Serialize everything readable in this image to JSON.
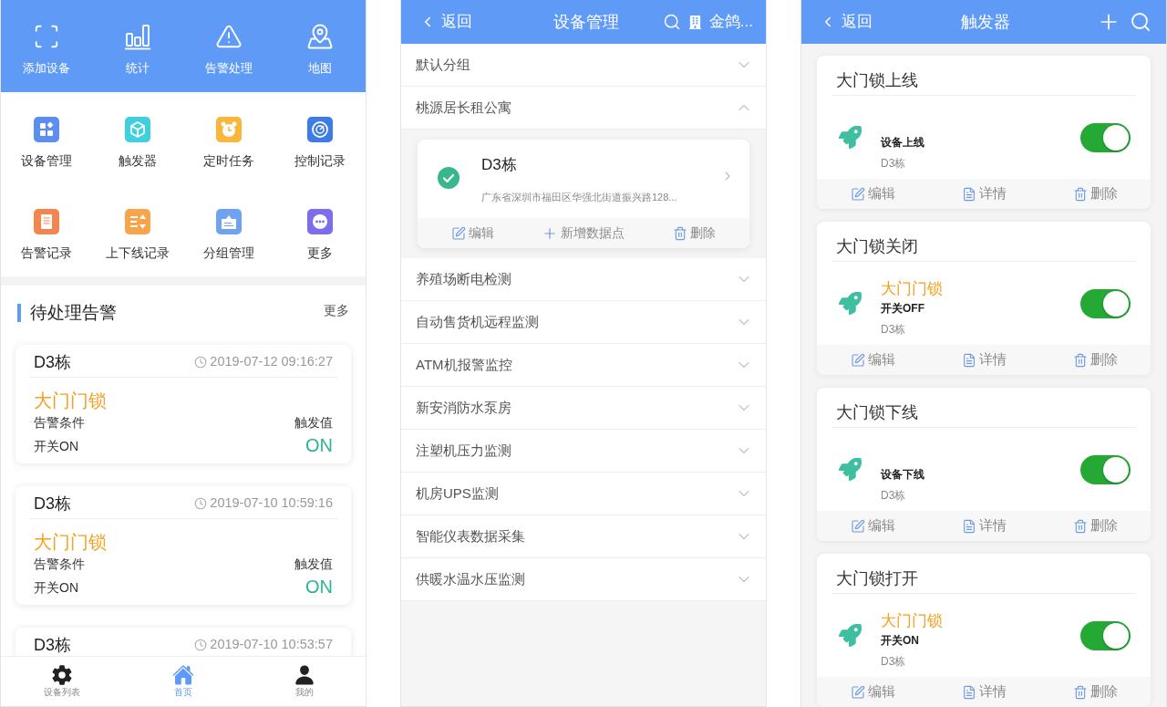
{
  "home_screen": {
    "quick_actions": [
      {
        "label": "添加设备"
      },
      {
        "label": "统计"
      },
      {
        "label": "告警处理"
      },
      {
        "label": "地图"
      }
    ],
    "features": [
      {
        "label": "设备管理"
      },
      {
        "label": "触发器"
      },
      {
        "label": "定时任务"
      },
      {
        "label": "控制记录"
      },
      {
        "label": "告警记录"
      },
      {
        "label": "上下线记录"
      },
      {
        "label": "分组管理"
      },
      {
        "label": "更多"
      }
    ],
    "pending_alarms": {
      "title": "待处理告警",
      "more": "更多",
      "cards": [
        {
          "building": "D3栋",
          "time": "2019-07-12 09:16:27",
          "device": "大门门锁",
          "condition_label": "告警条件",
          "trigger_label": "触发值",
          "condition": "开关ON",
          "trigger_value": "ON"
        },
        {
          "building": "D3栋",
          "time": "2019-07-10 10:59:16",
          "device": "大门门锁",
          "condition_label": "告警条件",
          "trigger_label": "触发值",
          "condition": "开关ON",
          "trigger_value": "ON"
        },
        {
          "building": "D3栋",
          "time": "2019-07-10 10:53:57"
        }
      ]
    },
    "bottom_nav": [
      {
        "label": "设备列表",
        "selected": false
      },
      {
        "label": "首页",
        "selected": true
      },
      {
        "label": "我的",
        "selected": false
      }
    ]
  },
  "device_management_screen": {
    "header": {
      "back": "返回",
      "title": "设备管理",
      "organization": "金鸽..."
    },
    "groups": [
      {
        "name": "默认分组",
        "expanded": false
      },
      {
        "name": "桃源居长租公寓",
        "expanded": true,
        "devices": [
          {
            "name": "D3栋",
            "address": "广东省深圳市福田区华强北街道振兴路128...",
            "checked": true,
            "actions": [
              "编辑",
              "新增数据点",
              "删除"
            ]
          }
        ]
      },
      {
        "name": "养殖场断电检测",
        "expanded": false
      },
      {
        "name": "自动售货机远程监测",
        "expanded": false
      },
      {
        "name": "ATM机报警监控",
        "expanded": false
      },
      {
        "name": "新安消防水泵房",
        "expanded": false
      },
      {
        "name": "注塑机压力监测",
        "expanded": false
      },
      {
        "name": "机房UPS监测",
        "expanded": false
      },
      {
        "name": "智能仪表数据采集",
        "expanded": false
      },
      {
        "name": "供暖水温水压监测",
        "expanded": false
      }
    ]
  },
  "trigger_screen": {
    "header": {
      "back": "返回",
      "title": "触发器"
    },
    "triggers": [
      {
        "title": "大门锁上线",
        "event": "设备上线",
        "location": "D3栋",
        "on": true,
        "actions": [
          "编辑",
          "详情",
          "删除"
        ]
      },
      {
        "title": "大门锁关闭",
        "device": "大门门锁",
        "event": "开关OFF",
        "location": "D3栋",
        "on": true,
        "actions": [
          "编辑",
          "详情",
          "删除"
        ]
      },
      {
        "title": "大门锁下线",
        "event": "设备下线",
        "location": "D3栋",
        "on": true,
        "actions": [
          "编辑",
          "详情",
          "删除"
        ]
      },
      {
        "title": "大门锁打开",
        "device": "大门门锁",
        "event": "开关ON",
        "location": "D3栋",
        "on": true,
        "actions": [
          "编辑",
          "详情",
          "删除"
        ]
      }
    ]
  }
}
